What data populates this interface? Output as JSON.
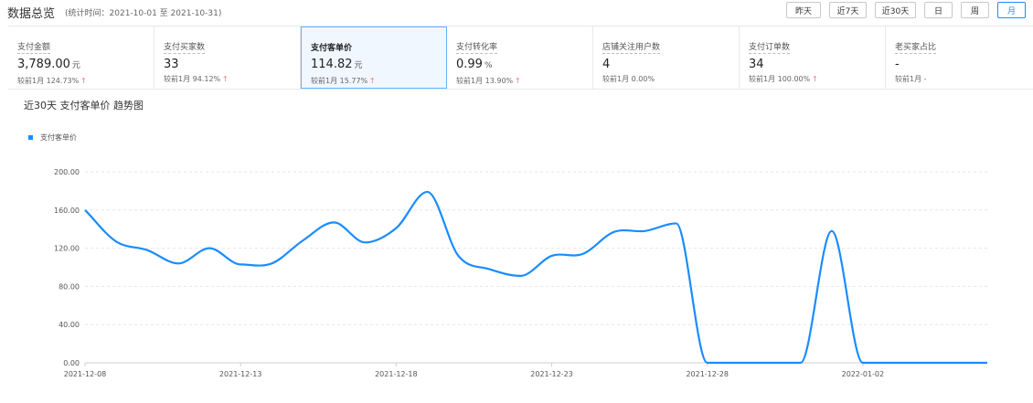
{
  "header": {
    "title": "数据总览",
    "stat_period": "(统计时间：2021-10-01 至 2021-10-31)",
    "range_buttons": [
      {
        "label": "昨天",
        "active": false
      },
      {
        "label": "近7天",
        "active": false
      },
      {
        "label": "近30天",
        "active": false
      },
      {
        "label": "日",
        "active": false
      },
      {
        "label": "周",
        "active": false
      },
      {
        "label": "月",
        "active": true
      }
    ]
  },
  "metrics": [
    {
      "label": "支付金额",
      "value": "3,789.00",
      "unit": "元",
      "compare": "较前1月 124.73%",
      "trend": "up",
      "active": false
    },
    {
      "label": "支付买家数",
      "value": "33",
      "unit": "",
      "compare": "较前1月 94.12%",
      "trend": "up",
      "active": false
    },
    {
      "label": "支付客单价",
      "value": "114.82",
      "unit": "元",
      "compare": "较前1月 15.77%",
      "trend": "up",
      "active": true
    },
    {
      "label": "支付转化率",
      "value": "0.99",
      "unit": "%",
      "compare": "较前1月 13.90%",
      "trend": "up",
      "active": false
    },
    {
      "label": "店铺关注用户数",
      "value": "4",
      "unit": "",
      "compare": "较前1月 0.00%",
      "trend": "",
      "active": false
    },
    {
      "label": "支付订单数",
      "value": "34",
      "unit": "",
      "compare": "较前1月 100.00%",
      "trend": "up",
      "active": false
    },
    {
      "label": "老买家占比",
      "value": "-",
      "unit": "",
      "compare": "较前1月 -",
      "trend": "",
      "active": false
    }
  ],
  "chart_panel": {
    "title": "近30天 支付客单价 趋势图",
    "legend": "支付客单价"
  },
  "colors": {
    "accent": "#1a8cff",
    "up": "#e53935"
  },
  "chart_data": {
    "type": "line",
    "x": [
      "2021-12-08",
      "2021-12-09",
      "2021-12-10",
      "2021-12-11",
      "2021-12-12",
      "2021-12-13",
      "2021-12-14",
      "2021-12-15",
      "2021-12-16",
      "2021-12-17",
      "2021-12-18",
      "2021-12-19",
      "2021-12-20",
      "2021-12-21",
      "2021-12-22",
      "2021-12-23",
      "2021-12-24",
      "2021-12-25",
      "2021-12-26",
      "2021-12-27",
      "2021-12-28",
      "2021-12-29",
      "2021-12-30",
      "2021-12-31",
      "2022-01-01",
      "2022-01-02",
      "2022-01-03",
      "2022-01-04",
      "2022-01-05",
      "2022-01-06"
    ],
    "x_ticks": [
      "2021-12-08",
      "2021-12-13",
      "2021-12-18",
      "2021-12-23",
      "2021-12-28",
      "2022-01-02"
    ],
    "series": [
      {
        "name": "支付客单价",
        "values": [
          160,
          127,
          118,
          104,
          120,
          103,
          104,
          128,
          147,
          126,
          141,
          179,
          112,
          98,
          91,
          112,
          114,
          137,
          138,
          146,
          0,
          0,
          0,
          0,
          138,
          0,
          0,
          0,
          0,
          0
        ]
      }
    ],
    "ylim": [
      0,
      200
    ],
    "y_ticks": [
      "0.00",
      "40.00",
      "80.00",
      "120.00",
      "160.00",
      "200.00"
    ],
    "grid": true,
    "legend_position": "top-left"
  }
}
